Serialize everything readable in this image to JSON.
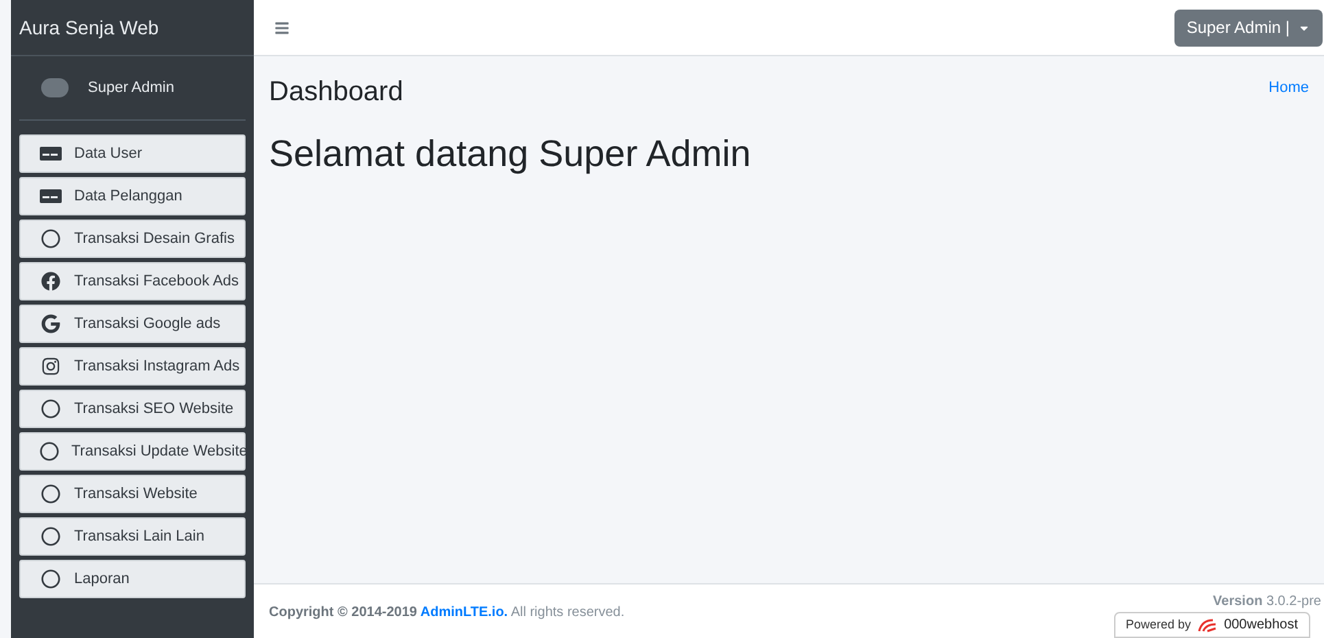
{
  "brand": "Aura Senja Web",
  "user": {
    "name": "Super Admin"
  },
  "menu": [
    {
      "label": "Data User",
      "kind": "card"
    },
    {
      "label": "Data Pelanggan",
      "kind": "card"
    },
    {
      "label": "Transaksi Desain Grafis",
      "kind": "circle"
    },
    {
      "label": "Transaksi Facebook Ads",
      "kind": "facebook"
    },
    {
      "label": "Transaksi Google ads",
      "kind": "google"
    },
    {
      "label": "Transaksi Instagram Ads",
      "kind": "instagram"
    },
    {
      "label": "Transaksi SEO Website",
      "kind": "circle"
    },
    {
      "label": "Transaksi Update Website",
      "kind": "circle"
    },
    {
      "label": "Transaksi Website",
      "kind": "circle"
    },
    {
      "label": "Transaksi Lain Lain",
      "kind": "circle"
    },
    {
      "label": "Laporan",
      "kind": "circle"
    }
  ],
  "navbar": {
    "user_button": "Super Admin |"
  },
  "page": {
    "title": "Dashboard",
    "breadcrumb": "Home",
    "heading": "Selamat datang Super Admin"
  },
  "footer": {
    "copyright_prefix": "Copyright © 2014-2019",
    "link": "AdminLTE.io.",
    "suffix": "All rights reserved.",
    "version_label": "Version",
    "version": "3.0.2-pre"
  },
  "badge": {
    "prefix": "Powered by",
    "brand": "000webhost"
  }
}
